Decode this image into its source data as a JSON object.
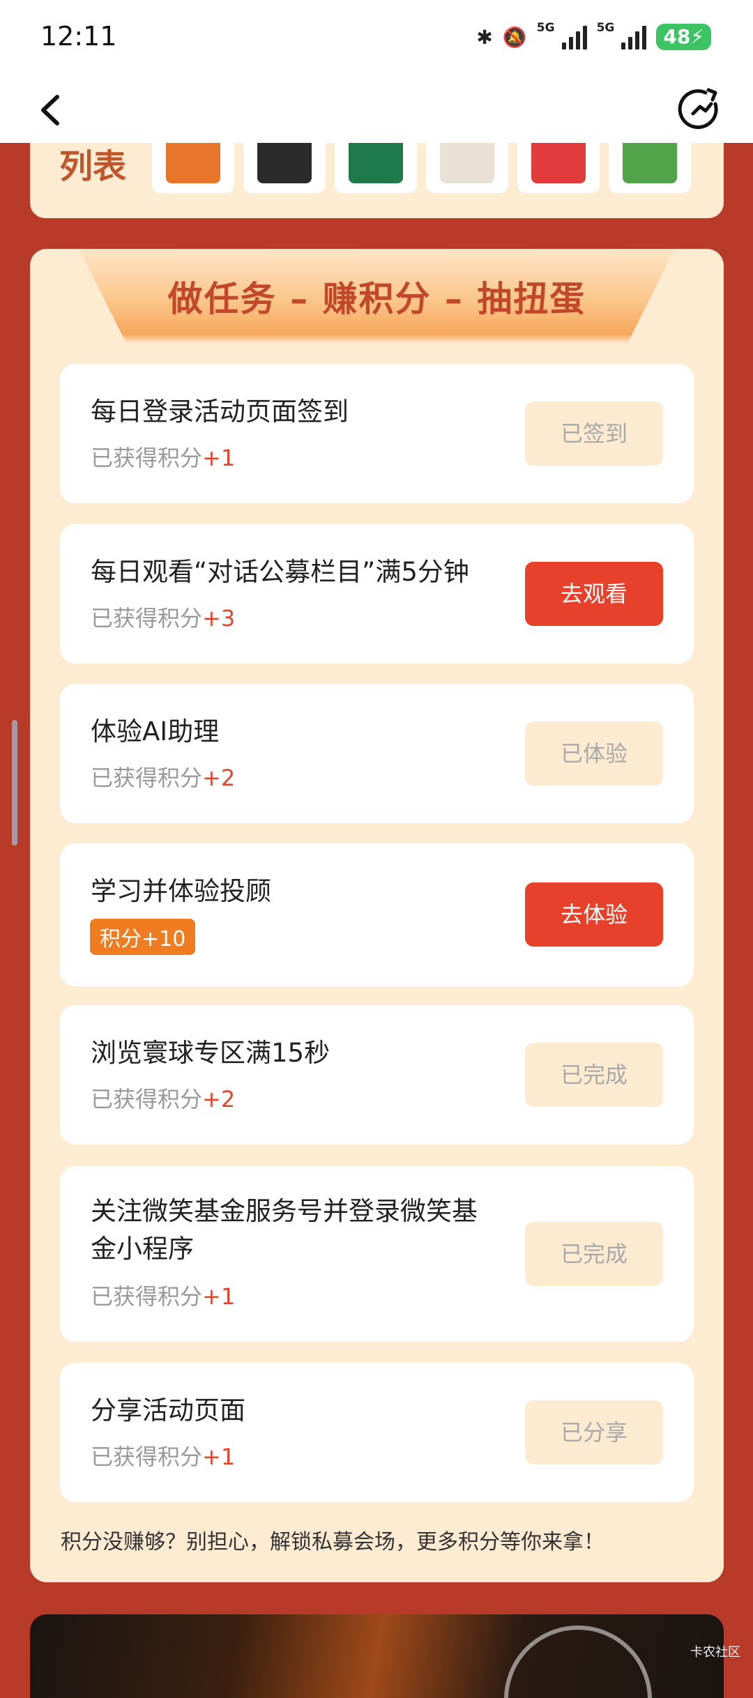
{
  "status": {
    "time": "12:11",
    "net1": "5G",
    "net2": "5G",
    "battery": "48"
  },
  "prize_list": {
    "title": "列表",
    "thumb_colors": [
      "#e8762a",
      "#2b2b2b",
      "#1e7a4a",
      "#e9e2d4",
      "#e23b3b",
      "#53a34a"
    ]
  },
  "task_section": {
    "banner_title": "做任务 – 赚积分 – 抽扭蛋",
    "tasks": [
      {
        "title": "每日登录活动页面签到",
        "points_label": "已获得积分",
        "points_value": "+1",
        "button": "已签到"
      },
      {
        "title": "每日观看“对话公募栏目”满5分钟",
        "points_label": "已获得积分",
        "points_value": "+3",
        "button": "去观看"
      },
      {
        "title": "体验AI助理",
        "points_label": "已获得积分",
        "points_value": "+2",
        "button": "已体验"
      },
      {
        "title": "学习并体验投顾",
        "badge": "积分+10",
        "button": "去体验"
      },
      {
        "title": "浏览寰球专区满15秒",
        "points_label": "已获得积分",
        "points_value": "+2",
        "button": "已完成"
      },
      {
        "title": "关注微笑基金服务号并登录微笑基金小程序",
        "points_label": "已获得积分",
        "points_value": "+1",
        "button": "已完成"
      },
      {
        "title": "分享活动页面",
        "points_label": "已获得积分",
        "points_value": "+1",
        "button": "已分享"
      }
    ],
    "footnote": "积分没赚够？别担心，解锁私募会场，更多积分等你来拿！"
  },
  "watermark": "卡农社区",
  "colors": {
    "accent": "#e8412b",
    "page_bg": "#b83a28",
    "card_bg": "#fdebd2"
  }
}
